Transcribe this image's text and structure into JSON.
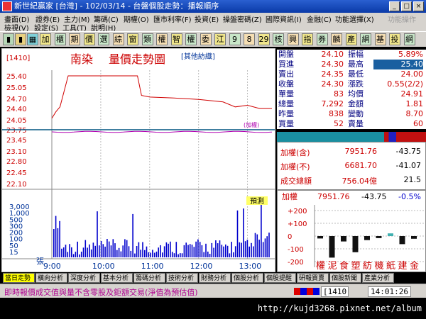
{
  "window": {
    "title": "新世紀贏家 [台灣] - 102/03/14 - 台盤個股走勢：播報順序",
    "buttons": [
      "_",
      "□",
      "×"
    ]
  },
  "menu": {
    "row1": [
      "畫面(D)",
      "證券(E)",
      "主力(M)",
      "籌碼(C)",
      "期權(O)",
      "匯市利率(F)",
      "投資(E)",
      "操盤密碼(Z)",
      "國際資訊(I)",
      "金融(C)",
      "功能選擇(X)"
    ],
    "row1_disabled": "功能操作",
    "row2": [
      "檢視(V)",
      "設定(S)",
      "工具(T)",
      "說明(H)"
    ]
  },
  "toolbar": [
    "加",
    "櫃",
    "期",
    "價",
    "選",
    "綜",
    "窗",
    "類",
    "權",
    "智",
    "權",
    "委",
    "江",
    "9",
    "8",
    "29",
    "核",
    "興",
    "指",
    "券",
    "麟",
    "產",
    "網",
    "基",
    "投",
    "網"
  ],
  "chart": {
    "code": "[1410]",
    "name": "南染",
    "heading": "量價走勢圖",
    "tag": "[其他紡織]",
    "price_ticks": [
      "25.40",
      "25.05",
      "24.70",
      "24.40",
      "24.05",
      "23.75",
      "23.45",
      "23.10",
      "22.80",
      "22.45",
      "22.10"
    ],
    "ref_label": "(加權)",
    "forecast_label": "預測",
    "vol_ticks": [
      "3,000",
      "1,000",
      "500",
      "300",
      "200",
      "100",
      "50",
      "15"
    ],
    "vol_unit": "張",
    "time_ticks": [
      "9:00",
      "10:00",
      "11:00",
      "12:00",
      "13:00"
    ]
  },
  "chart_data": {
    "type": "line",
    "x_range": [
      "9:00",
      "13:30"
    ],
    "ylim": [
      22.1,
      25.4
    ],
    "reference_price": 23.75,
    "price_series": [
      {
        "t": "9:00",
        "v": 24.1
      },
      {
        "t": "9:05",
        "v": 24.3
      },
      {
        "t": "9:10",
        "v": 24.45
      },
      {
        "t": "9:20",
        "v": 25.4
      },
      {
        "t": "9:40",
        "v": 25.4
      },
      {
        "t": "10:00",
        "v": 25.4
      },
      {
        "t": "10:20",
        "v": 25.4
      },
      {
        "t": "10:45",
        "v": 25.4
      },
      {
        "t": "10:50",
        "v": 24.8
      },
      {
        "t": "11:00",
        "v": 24.75
      },
      {
        "t": "11:30",
        "v": 24.72
      },
      {
        "t": "12:00",
        "v": 24.68
      },
      {
        "t": "12:30",
        "v": 24.6
      },
      {
        "t": "12:45",
        "v": 24.45
      },
      {
        "t": "13:00",
        "v": 24.5
      },
      {
        "t": "13:15",
        "v": 24.4
      },
      {
        "t": "13:30",
        "v": 24.4
      }
    ]
  },
  "quote": {
    "rows": [
      {
        "l1": "開盤",
        "v1": "24.10",
        "l2": "振幅",
        "v2": "5.89%"
      },
      {
        "l1": "買進",
        "v1": "24.30",
        "l2": "最高",
        "v2": "25.40"
      },
      {
        "l1": "賣出",
        "v1": "24.35",
        "l2": "最低",
        "v2": "24.00"
      },
      {
        "l1": "收盤",
        "v1": "24.30",
        "l2": "漲跌",
        "v2": "0.55(2/2)"
      },
      {
        "l1": "單量",
        "v1": "83",
        "l2": "均價",
        "v2": "24.91"
      },
      {
        "l1": "總量",
        "v1": "7,292",
        "l2": "金額",
        "v2": "1.81"
      },
      {
        "l1": "昨量",
        "v1": "838",
        "l2": "變動",
        "v2": "8.70"
      },
      {
        "l1": "買量",
        "v1": "52",
        "l2": "賣量",
        "v2": "60"
      }
    ]
  },
  "index": {
    "rows": [
      {
        "label": "加權(含)",
        "value": "7951.76",
        "change": "-43.75"
      },
      {
        "label": "加權(不)",
        "value": "6681.70",
        "change": "-41.07"
      },
      {
        "label": "成交總額",
        "value": "756.04億",
        "change": "21.5"
      }
    ]
  },
  "sector": {
    "header_label": "加權",
    "header_value": "7951.76",
    "header_change": "-43.75",
    "header_pct": "-0.5%",
    "ticks": [
      "+200",
      "+100",
      "0",
      "-100",
      "-200"
    ],
    "categories": [
      "權",
      "泥",
      "食",
      "塑",
      "紡",
      "機",
      "紙",
      "建",
      "金"
    ]
  },
  "tabs": [
    "當日走勢",
    "橫向分析",
    "深度分析",
    "基本分析",
    "籌碼分析",
    "技術分析",
    "財務分析",
    "個股分析",
    "個股提醒",
    "研報買賣",
    "個股新聞",
    "產業分析"
  ],
  "status": {
    "message": "即時報價成交值與量不含零股及鉅額交易(淨值為預估值)",
    "code": "[1410",
    "time": "14:01:26"
  },
  "watermark": "http://kujd3268.pixnet.net/album"
}
